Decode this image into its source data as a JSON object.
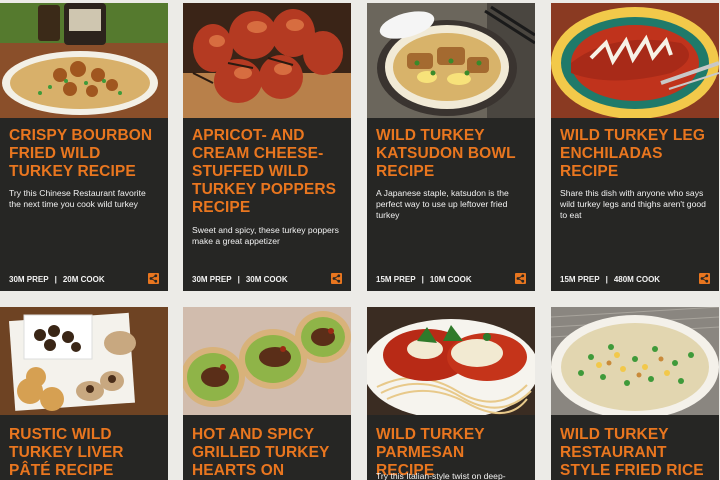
{
  "recipes": [
    {
      "title": "Crispy Bourbon Fried Wild Turkey Recipe",
      "description": "Try this Chinese Restaurant favorite the next time you cook wild turkey",
      "prep": "30M PREP",
      "cook": "20M COOK",
      "image_icon": "bourbon-fried-turkey-photo"
    },
    {
      "title": "Apricot- and Cream Cheese-Stuffed Wild Turkey Poppers Recipe",
      "description": "Sweet and spicy, these turkey poppers make a great appetizer",
      "prep": "30M PREP",
      "cook": "30M COOK",
      "image_icon": "turkey-poppers-photo"
    },
    {
      "title": "Wild Turkey Katsudon Bowl Recipe",
      "description": "A Japanese staple, katsudon is the perfect way to use up leftover fried turkey",
      "prep": "15M PREP",
      "cook": "10M COOK",
      "image_icon": "katsudon-bowl-photo"
    },
    {
      "title": "Wild Turkey Leg Enchiladas Recipe",
      "description": "Share this dish with anyone who says wild turkey legs and thighs aren't good to eat",
      "prep": "15M PREP",
      "cook": "480M COOK",
      "image_icon": "enchiladas-photo"
    },
    {
      "title": "Rustic Wild Turkey Liver Pâté Recipe",
      "image_icon": "liver-pate-photo"
    },
    {
      "title": "Hot and Spicy Grilled Turkey Hearts on",
      "image_icon": "turkey-hearts-photo"
    },
    {
      "title": "Wild Turkey Parmesan Recipe",
      "description": "Try this Italian-style twist on deep-",
      "image_icon": "turkey-parmesan-photo"
    },
    {
      "title": "Wild Turkey Restaurant Style Fried Rice Recipe",
      "image_icon": "fried-rice-photo"
    }
  ],
  "share_icon": "share-icon",
  "colors": {
    "accent": "#e9761f",
    "card_bg": "#262624",
    "page_bg": "#ecebe7",
    "text": "#f2f2f2"
  }
}
